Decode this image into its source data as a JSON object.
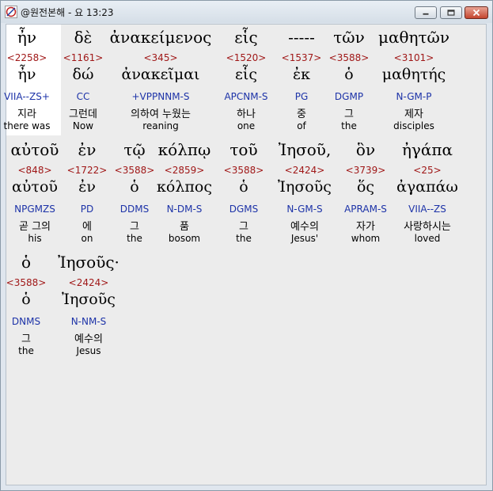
{
  "window": {
    "title": "@원전본해 - 요 13:23"
  },
  "controls": {
    "minimize": "minimize",
    "maximize": "maximize",
    "close": "close"
  },
  "rows": [
    {
      "words": [
        {
          "greek": "ἦν",
          "strong": "<2258>",
          "lemma": "ἦν",
          "morph": "VIIA--ZS+",
          "korean": "지라",
          "english": "there was",
          "selected": true
        },
        {
          "greek": "δὲ",
          "strong": "<1161>",
          "lemma": "δώ",
          "morph": "CC",
          "korean": "그런데",
          "english": "Now"
        },
        {
          "greek": "ἀνακείμενος",
          "strong": "<345>",
          "lemma": "ἀνακεῖμαι",
          "morph": "+VPPNNM-S",
          "korean": "의하여 누웠는",
          "english": "reaning"
        },
        {
          "greek": "εἷς",
          "strong": "<1520>",
          "lemma": "εἷς",
          "morph": "APCNM-S",
          "korean": "하나",
          "english": "one"
        },
        {
          "greek": "-----",
          "strong": "<1537>",
          "lemma": "ἐκ",
          "morph": "PG",
          "korean": "중",
          "english": "of"
        },
        {
          "greek": "τῶν",
          "strong": "<3588>",
          "lemma": "ὁ",
          "morph": "DGMP",
          "korean": "그",
          "english": "the"
        },
        {
          "greek": "μαθητῶν",
          "strong": "<3101>",
          "lemma": "μαθητής",
          "morph": "N-GM-P",
          "korean": "제자",
          "english": "disciples"
        }
      ]
    },
    {
      "words": [
        {
          "greek": "αὐτοῦ",
          "strong": "<848>",
          "lemma": "αὐτοῦ",
          "morph": "NPGMZS",
          "korean": "곧 그의",
          "english": "his"
        },
        {
          "greek": "ἐν",
          "strong": "<1722>",
          "lemma": "ἐν",
          "morph": "PD",
          "korean": "에",
          "english": "on"
        },
        {
          "greek": "τῷ",
          "strong": "<3588>",
          "lemma": "ὁ",
          "morph": "DDMS",
          "korean": "그",
          "english": "the"
        },
        {
          "greek": "κόλπῳ",
          "strong": "<2859>",
          "lemma": "κόλπος",
          "morph": "N-DM-S",
          "korean": "품",
          "english": "bosom"
        },
        {
          "greek": "τοῦ",
          "strong": "<3588>",
          "lemma": "ὁ",
          "morph": "DGMS",
          "korean": "그",
          "english": "the"
        },
        {
          "greek": "Ἰησοῦ,",
          "strong": "<2424>",
          "lemma": "Ἰησοῦς",
          "morph": "N-GM-S",
          "korean": "예수의",
          "english": "Jesus'"
        },
        {
          "greek": "ὃν",
          "strong": "<3739>",
          "lemma": "ὅς",
          "morph": "APRAM-S",
          "korean": "자가",
          "english": "whom"
        },
        {
          "greek": "ἠγάπα",
          "strong": "<25>",
          "lemma": "ἀγαπάω",
          "morph": "VIIA--ZS",
          "korean": "사랑하시는",
          "english": "loved"
        }
      ]
    },
    {
      "words": [
        {
          "greek": "ὁ",
          "strong": "<3588>",
          "lemma": "ὁ",
          "morph": "DNMS",
          "korean": "그",
          "english": "the"
        },
        {
          "greek": "Ἰησοῦς·",
          "strong": "<2424>",
          "lemma": "Ἰησοῦς",
          "morph": "N-NM-S",
          "korean": "예수의",
          "english": "Jesus"
        }
      ]
    }
  ]
}
